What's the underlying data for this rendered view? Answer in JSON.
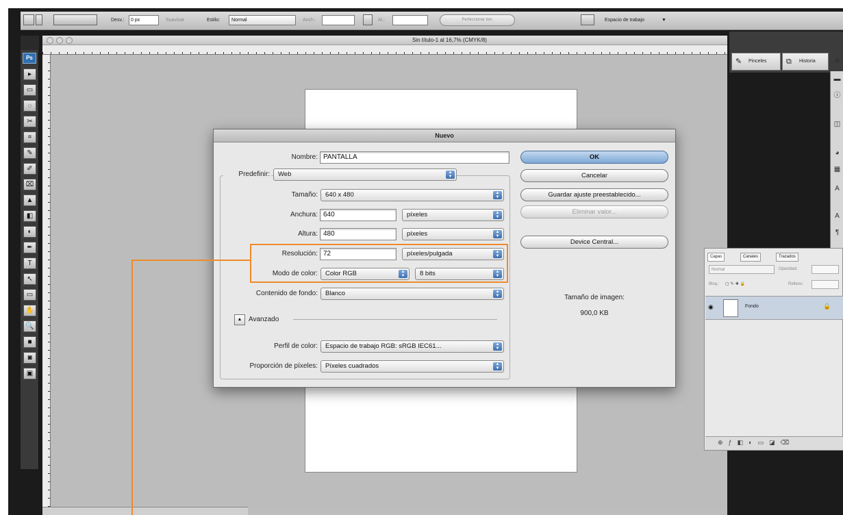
{
  "options_bar": {
    "feather_label": "Desv.:",
    "feather_value": "0 px",
    "antialias_label": "Suavizar",
    "style_label": "Estilo:",
    "style_value": "Normal",
    "width_label": "Anch.:",
    "height_label": "Al.:",
    "refine_button": "Perfeccionar bor.",
    "workspace_label": "Espacio de trabajo"
  },
  "document": {
    "title": "Sin título-1 al 16,7% (CMYK/8)"
  },
  "toolbar": {
    "logo": "Ps",
    "tools": [
      "▸",
      "▭",
      "◌",
      "✂",
      "⌗",
      "✎",
      "✐",
      "⌧",
      "▲",
      "◧",
      "◐",
      "✒",
      "T",
      "↖",
      "▭",
      "✋",
      "🔍",
      "■",
      "◙",
      "▣"
    ]
  },
  "dock": {
    "presets_label": "Pinceles",
    "history_label": "Historia"
  },
  "layers_panel": {
    "tabs": [
      "Capas",
      "Canales",
      "Trazados"
    ],
    "blend_mode": "Normal",
    "opacity_label": "Opacidad:",
    "lock_label": "Bloq.:",
    "fill_label": "Relleno:",
    "layer_name": "Fondo"
  },
  "dialog": {
    "title": "Nuevo",
    "name_label": "Nombre:",
    "name_value": "PANTALLA",
    "preset_label": "Predefinir:",
    "preset_value": "Web",
    "size_label": "Tamaño:",
    "size_value": "640 x 480",
    "width_label": "Anchura:",
    "width_value": "640",
    "width_unit": "píxeles",
    "height_label": "Altura:",
    "height_value": "480",
    "height_unit": "píxeles",
    "resolution_label": "Resolución:",
    "resolution_value": "72",
    "resolution_unit": "píxeles/pulgada",
    "color_mode_label": "Modo de color:",
    "color_mode_value": "Color RGB",
    "bit_depth_value": "8 bits",
    "background_label": "Contenido de fondo:",
    "background_value": "Blanco",
    "advanced_label": "Avanzado",
    "color_profile_label": "Perfil de color:",
    "color_profile_value": "Espacio de trabajo RGB: sRGB IEC61...",
    "pixel_aspect_label": "Proporción de píxeles:",
    "pixel_aspect_value": "Píxeles cuadrados",
    "ok_button": "OK",
    "cancel_button": "Cancelar",
    "save_preset_button": "Guardar ajuste preestablecido...",
    "delete_preset_button": "Eliminar valor...",
    "device_central_button": "Device Central...",
    "image_size_label": "Tamaño de imagen:",
    "image_size_value": "900,0 KB"
  },
  "colors": {
    "highlight": "#ef8a2b",
    "default_button": "#7ea9d6"
  }
}
